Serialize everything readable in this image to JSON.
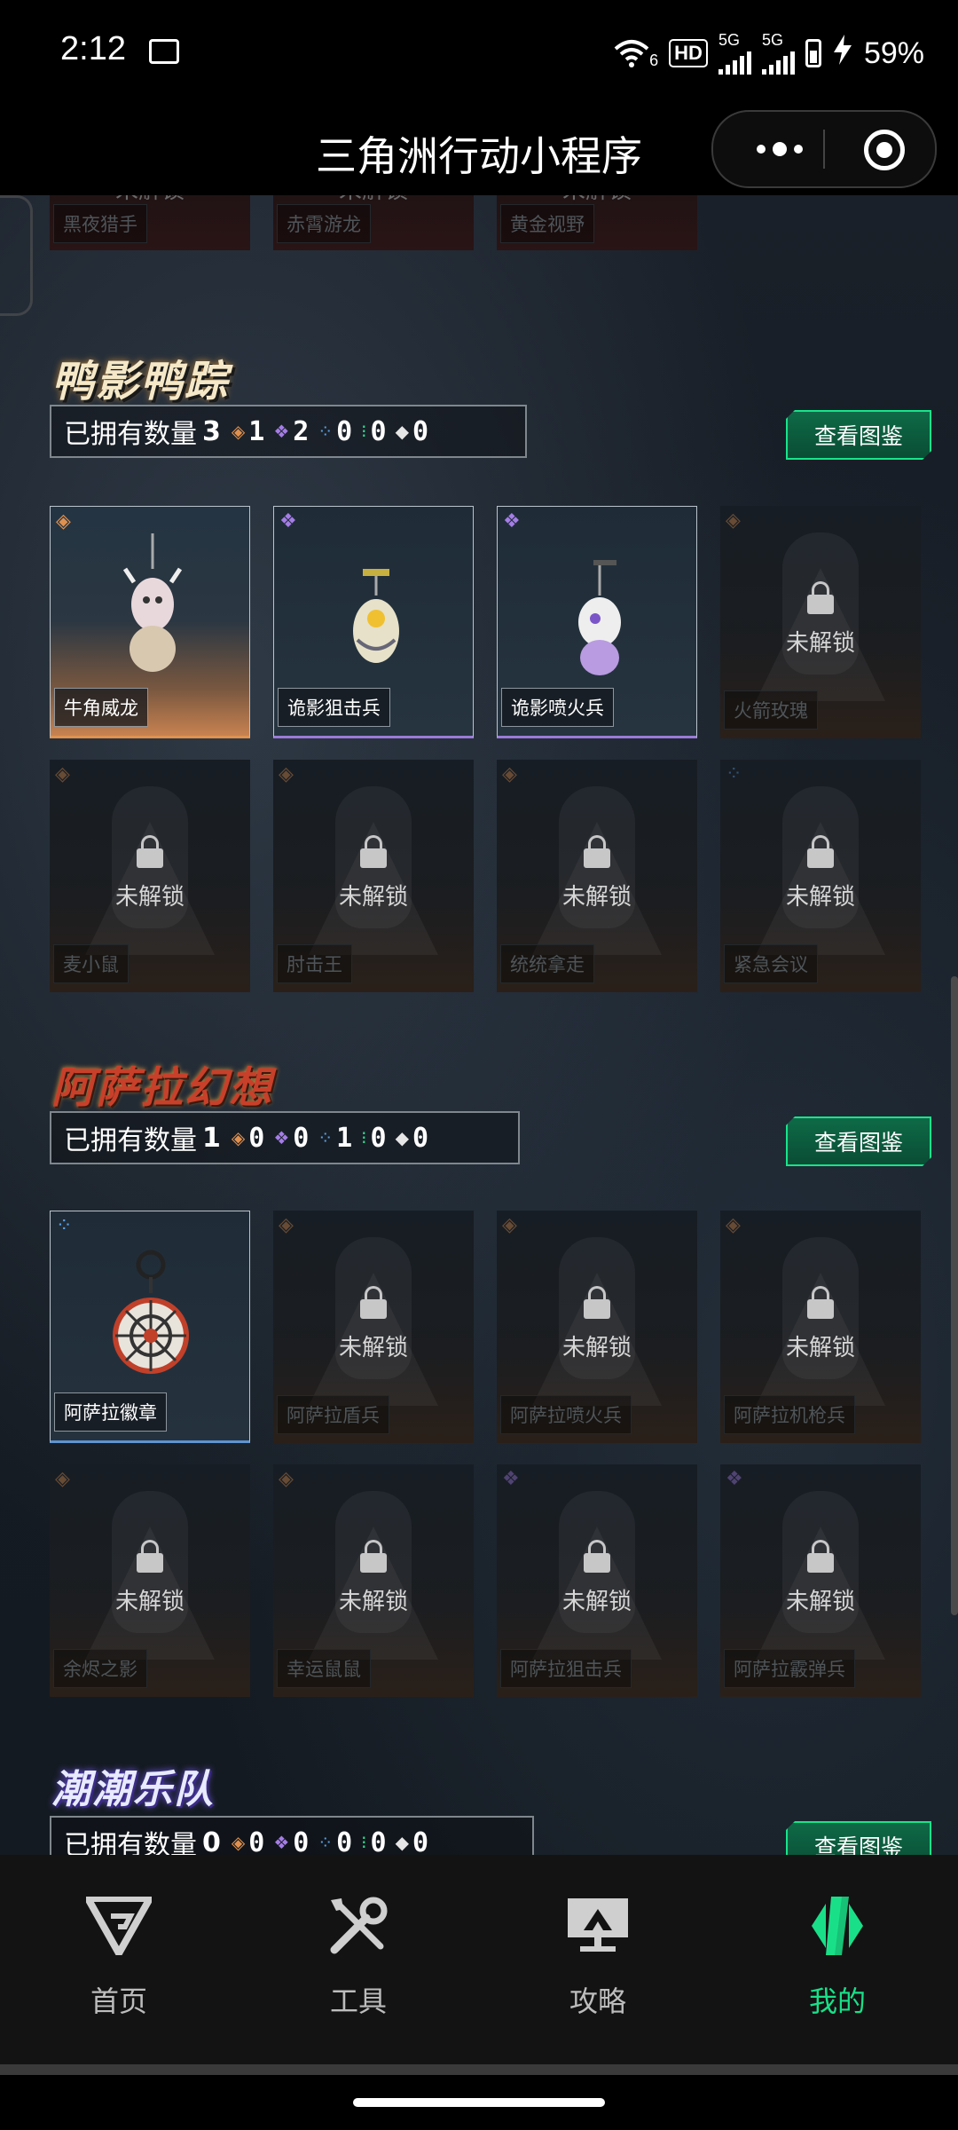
{
  "status_bar": {
    "time": "2:12",
    "wifi_num": "6",
    "hd": "HD",
    "hd_sub": "1\n2",
    "sim1": "5G",
    "sim2": "5G",
    "battery": "59%"
  },
  "title_bar": {
    "title": "三角洲行动小程序"
  },
  "top_row": {
    "names": [
      "黑夜猎手",
      "赤霄游龙",
      "黄金视野"
    ],
    "lock_text": "未解锁"
  },
  "sections": [
    {
      "logo": "鸭影鸭踪",
      "owned_label": "已拥有数量",
      "owned_count": "3",
      "rarity_counts": [
        "1",
        "2",
        "0",
        "0",
        "0"
      ],
      "view_button": "查看图鉴",
      "items": [
        {
          "name": "牛角威龙",
          "owned": true,
          "rarity": "gold"
        },
        {
          "name": "诡影狙击兵",
          "owned": true,
          "rarity": "purple"
        },
        {
          "name": "诡影喷火兵",
          "owned": true,
          "rarity": "purple"
        },
        {
          "name": "火箭玫瑰",
          "owned": false,
          "rarity": "gold",
          "lock": "未解锁"
        },
        {
          "name": "麦小鼠",
          "owned": false,
          "rarity": "gold",
          "lock": "未解锁"
        },
        {
          "name": "肘击王",
          "owned": false,
          "rarity": "gold",
          "lock": "未解锁"
        },
        {
          "name": "统统拿走",
          "owned": false,
          "rarity": "gold",
          "lock": "未解锁"
        },
        {
          "name": "紧急会议",
          "owned": false,
          "rarity": "blue",
          "lock": "未解锁"
        }
      ]
    },
    {
      "logo": "阿萨拉幻想",
      "owned_label": "已拥有数量",
      "owned_count": "1",
      "rarity_counts": [
        "0",
        "0",
        "1",
        "0",
        "0"
      ],
      "view_button": "查看图鉴",
      "items": [
        {
          "name": "阿萨拉徽章",
          "owned": true,
          "rarity": "blue"
        },
        {
          "name": "阿萨拉盾兵",
          "owned": false,
          "rarity": "gold",
          "lock": "未解锁"
        },
        {
          "name": "阿萨拉喷火兵",
          "owned": false,
          "rarity": "gold",
          "lock": "未解锁"
        },
        {
          "name": "阿萨拉机枪兵",
          "owned": false,
          "rarity": "gold",
          "lock": "未解锁"
        },
        {
          "name": "余烬之影",
          "owned": false,
          "rarity": "gold",
          "lock": "未解锁"
        },
        {
          "name": "幸运鼠鼠",
          "owned": false,
          "rarity": "gold",
          "lock": "未解锁"
        },
        {
          "name": "阿萨拉狙击兵",
          "owned": false,
          "rarity": "purple",
          "lock": "未解锁"
        },
        {
          "name": "阿萨拉霰弹兵",
          "owned": false,
          "rarity": "purple",
          "lock": "未解锁"
        }
      ]
    },
    {
      "logo": "潮潮乐队",
      "owned_label": "已拥有数量",
      "owned_count": "0",
      "rarity_counts": [
        "0",
        "0",
        "0",
        "0",
        "0"
      ],
      "view_button": "查看图鉴"
    }
  ],
  "rarity_colors": {
    "gold": "#e0914f",
    "purple": "#a57de6",
    "blue": "#5aa0e6",
    "green": "#2ee08f",
    "white": "#e6e6e6"
  },
  "tab_bar": {
    "tabs": [
      {
        "label": "首页",
        "icon": "home-logo-icon"
      },
      {
        "label": "工具",
        "icon": "tools-icon"
      },
      {
        "label": "攻略",
        "icon": "guide-monitor-icon"
      },
      {
        "label": "我的",
        "icon": "profile-logo-icon",
        "active": true
      }
    ],
    "accent": "#19e088"
  }
}
